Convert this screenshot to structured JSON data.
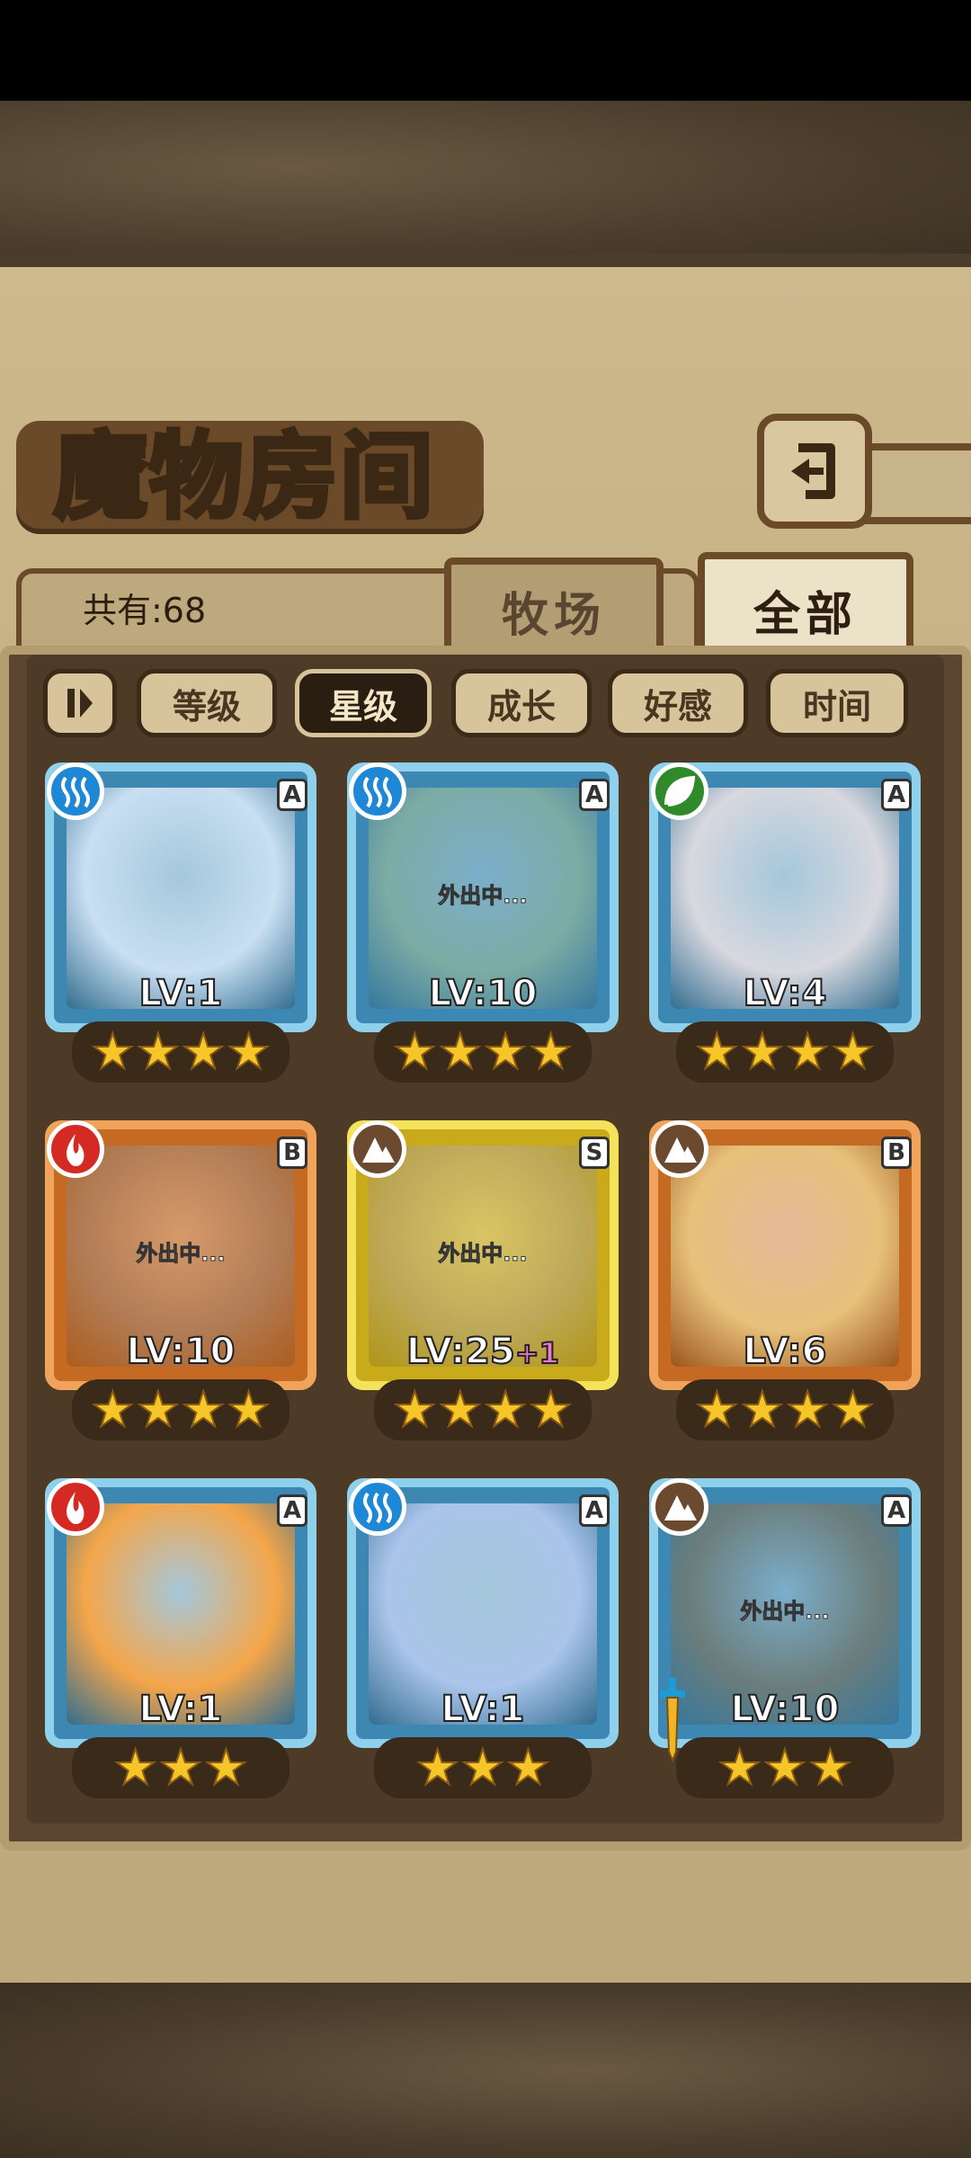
{
  "title": "魔物房间",
  "count_label": "共有:68",
  "tabs": {
    "pasture": "牧场",
    "all": "全部"
  },
  "filters": [
    "等级",
    "星级",
    "成长",
    "好感",
    "时间"
  ],
  "active_filter": "星级",
  "away_label": "外出中...",
  "cards": [
    {
      "element": "water",
      "rank": "A",
      "frame": "blue",
      "level": "LV:1",
      "stars": 4,
      "away": false,
      "portrait": "#c9dff2"
    },
    {
      "element": "water",
      "rank": "A",
      "frame": "blue",
      "level": "LV:10",
      "stars": 4,
      "away": true,
      "portrait": "#a7c49a"
    },
    {
      "element": "wood",
      "rank": "A",
      "frame": "blue",
      "level": "LV:4",
      "stars": 4,
      "away": false,
      "portrait": "#d8d8df"
    },
    {
      "element": "fire",
      "rank": "B",
      "frame": "orange",
      "level": "LV:10",
      "stars": 4,
      "away": true,
      "portrait": "#a58a7a"
    },
    {
      "element": "earth",
      "rank": "S",
      "frame": "gold",
      "level": "LV:25",
      "level_plus": "+1",
      "stars": 4,
      "away": true,
      "portrait": "#b7a886"
    },
    {
      "element": "earth",
      "rank": "B",
      "frame": "orange",
      "level": "LV:6",
      "stars": 4,
      "away": false,
      "portrait": "#e7c07a"
    },
    {
      "element": "fire",
      "rank": "A",
      "frame": "blue",
      "level": "LV:1",
      "stars": 3,
      "away": false,
      "portrait": "#f4a64a"
    },
    {
      "element": "water",
      "rank": "A",
      "frame": "blue",
      "level": "LV:1",
      "stars": 3,
      "away": false,
      "portrait": "#aac4ea"
    },
    {
      "element": "earth",
      "rank": "A",
      "frame": "blue",
      "level": "LV:10",
      "stars": 3,
      "away": true,
      "portrait": "#8a7656"
    }
  ],
  "colors": {
    "water_badge": "#1e88d6",
    "wood_badge": "#2f8a2a",
    "fire_badge": "#d42a23",
    "earth_badge": "#6b4a30",
    "star": "#f6c629"
  },
  "icons": [
    "back-arrow-icon",
    "filter-toggle-icon",
    "water-element-icon",
    "wood-element-icon",
    "fire-element-icon",
    "earth-element-icon",
    "star-icon",
    "sword-icon"
  ]
}
